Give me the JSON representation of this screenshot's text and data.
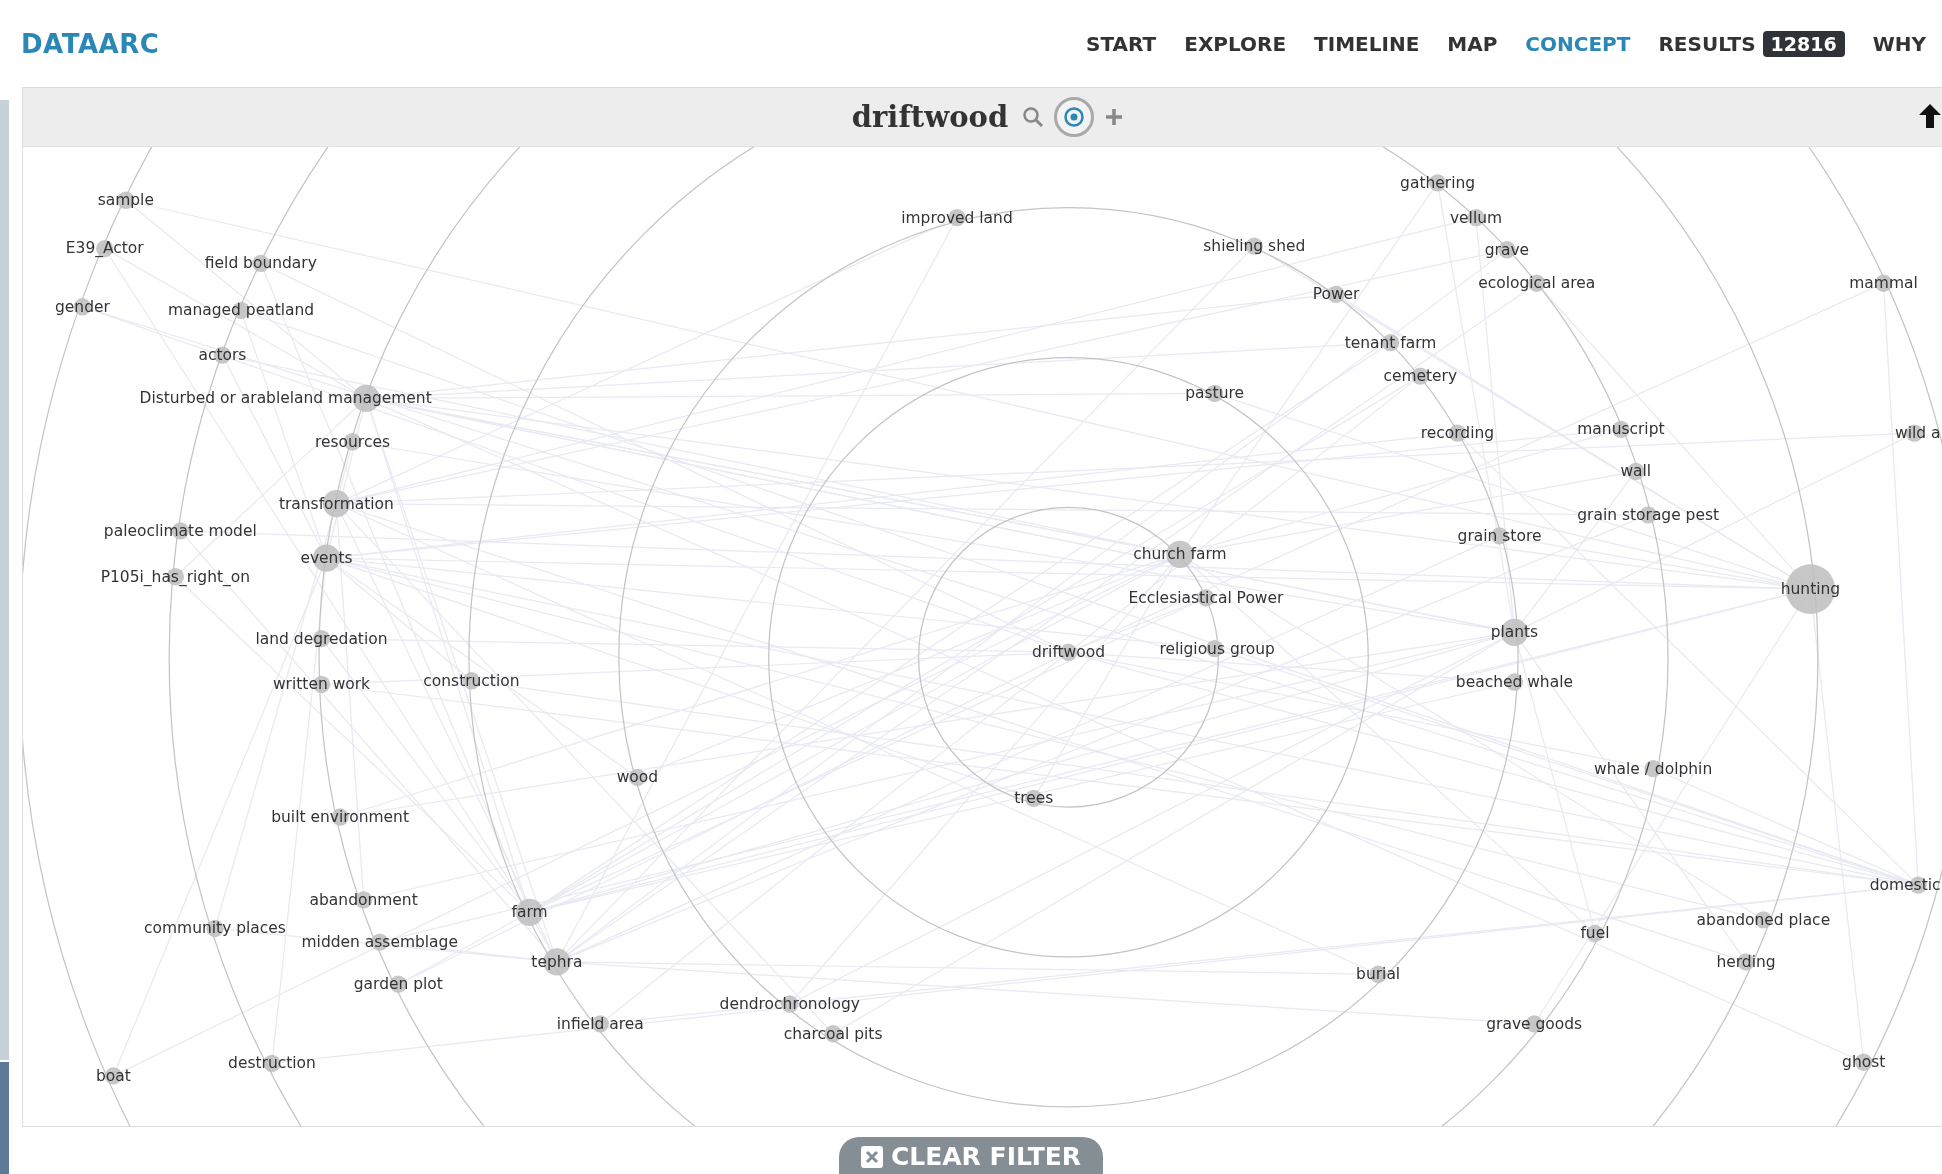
{
  "brand": "DATAARC",
  "nav": [
    {
      "label": "START",
      "selected": false
    },
    {
      "label": "EXPLORE",
      "selected": false
    },
    {
      "label": "TIMELINE",
      "selected": false
    },
    {
      "label": "MAP",
      "selected": false
    },
    {
      "label": "CONCEPT",
      "selected": true
    },
    {
      "label": "RESULTS",
      "selected": false,
      "badge": "12816"
    },
    {
      "label": "WHY",
      "selected": false
    }
  ],
  "concept": {
    "title": "driftwood"
  },
  "graph": {
    "nodes": [
      {
        "label": "sample",
        "kind": "minor"
      },
      {
        "label": "E39_Actor",
        "kind": "minor"
      },
      {
        "label": "field boundary",
        "kind": "minor"
      },
      {
        "label": "gender",
        "kind": "minor"
      },
      {
        "label": "managed peatland",
        "kind": "minor"
      },
      {
        "label": "actors",
        "kind": "minor"
      },
      {
        "label": "Disturbed or arableland management",
        "kind": "major"
      },
      {
        "label": "resources",
        "kind": "minor"
      },
      {
        "label": "transformation",
        "kind": "major"
      },
      {
        "label": "paleoclimate model",
        "kind": "minor"
      },
      {
        "label": "events",
        "kind": "major"
      },
      {
        "label": "P105i_has_right_on",
        "kind": "minor"
      },
      {
        "label": "land degredation",
        "kind": "minor"
      },
      {
        "label": "written work",
        "kind": "minor"
      },
      {
        "label": "construction",
        "kind": "minor"
      },
      {
        "label": "wood",
        "kind": "minor"
      },
      {
        "label": "built environment",
        "kind": "minor"
      },
      {
        "label": "abandonment",
        "kind": "minor"
      },
      {
        "label": "community places",
        "kind": "minor"
      },
      {
        "label": "midden assemblage",
        "kind": "minor"
      },
      {
        "label": "farm",
        "kind": "major"
      },
      {
        "label": "tephra",
        "kind": "major"
      },
      {
        "label": "garden plot",
        "kind": "minor"
      },
      {
        "label": "infield area",
        "kind": "minor"
      },
      {
        "label": "destruction",
        "kind": "minor"
      },
      {
        "label": "boat",
        "kind": "minor"
      },
      {
        "label": "dendrochronology",
        "kind": "minor"
      },
      {
        "label": "charcoal pits",
        "kind": "minor"
      },
      {
        "label": "improved land",
        "kind": "minor"
      },
      {
        "label": "shieling shed",
        "kind": "minor"
      },
      {
        "label": "pasture",
        "kind": "minor"
      },
      {
        "label": "church farm",
        "kind": "major"
      },
      {
        "label": "Ecclesiastical Power",
        "kind": "minor"
      },
      {
        "label": "driftwood",
        "kind": "minor"
      },
      {
        "label": "religious group",
        "kind": "minor"
      },
      {
        "label": "trees",
        "kind": "minor"
      },
      {
        "label": "gathering",
        "kind": "minor"
      },
      {
        "label": "vellum",
        "kind": "minor"
      },
      {
        "label": "grave",
        "kind": "minor"
      },
      {
        "label": "ecological area",
        "kind": "minor"
      },
      {
        "label": "Power",
        "kind": "minor"
      },
      {
        "label": "tenant farm",
        "kind": "minor"
      },
      {
        "label": "cemetery",
        "kind": "minor"
      },
      {
        "label": "mammal",
        "kind": "minor"
      },
      {
        "label": "recording",
        "kind": "minor"
      },
      {
        "label": "manuscript",
        "kind": "minor"
      },
      {
        "label": "wall",
        "kind": "minor"
      },
      {
        "label": "wild a",
        "kind": "minor"
      },
      {
        "label": "grain storage pest",
        "kind": "minor"
      },
      {
        "label": "grain store",
        "kind": "minor"
      },
      {
        "label": "hunting",
        "kind": "hub"
      },
      {
        "label": "plants",
        "kind": "major"
      },
      {
        "label": "beached whale",
        "kind": "minor"
      },
      {
        "label": "whale / dolphin",
        "kind": "minor"
      },
      {
        "label": "domestic",
        "kind": "minor"
      },
      {
        "label": "abandoned place",
        "kind": "minor"
      },
      {
        "label": "fuel",
        "kind": "minor"
      },
      {
        "label": "herding",
        "kind": "minor"
      },
      {
        "label": "burial",
        "kind": "minor"
      },
      {
        "label": "grave goods",
        "kind": "minor"
      },
      {
        "label": "ghost",
        "kind": "minor"
      }
    ]
  },
  "clear_filter": "CLEAR FILTER"
}
